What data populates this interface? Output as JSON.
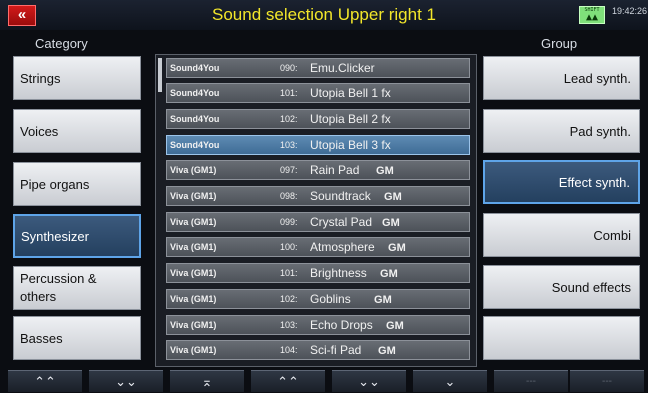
{
  "header": {
    "back_icon": "«",
    "title": "Sound selection Upper right 1",
    "rec_icon_text": "SHIFT",
    "rec_icon_glyph": "▲▲",
    "clock": "19:42:26"
  },
  "category": {
    "heading": "Category",
    "items": [
      {
        "label": "Strings"
      },
      {
        "label": "Voices"
      },
      {
        "label": "Pipe organs"
      },
      {
        "label": "Synthesizer"
      },
      {
        "label_line1": "Percussion &",
        "label_line2": "others"
      },
      {
        "label": "Basses"
      }
    ],
    "selected": "Synthesizer"
  },
  "group": {
    "heading": "Group",
    "items": [
      {
        "label": "Lead synth."
      },
      {
        "label": "Pad synth."
      },
      {
        "label": "Effect synth."
      },
      {
        "label": "Combi"
      },
      {
        "label": "Sound effects"
      },
      {
        "label": ""
      }
    ],
    "selected": "Effect synth."
  },
  "sounds": [
    {
      "source": "Sound4You",
      "number": "090:",
      "name": "Emu.Clicker",
      "gm": ""
    },
    {
      "source": "Sound4You",
      "number": "101:",
      "name": "Utopia Bell 1 fx",
      "gm": ""
    },
    {
      "source": "Sound4You",
      "number": "102:",
      "name": "Utopia Bell 2 fx",
      "gm": ""
    },
    {
      "source": "Sound4You",
      "number": "103:",
      "name": "Utopia Bell 3 fx",
      "gm": ""
    },
    {
      "source": "Viva (GM1)",
      "number": "097:",
      "name": "Rain Pad",
      "gm": "GM"
    },
    {
      "source": "Viva (GM1)",
      "number": "098:",
      "name": "Soundtrack",
      "gm": "GM"
    },
    {
      "source": "Viva (GM1)",
      "number": "099:",
      "name": "Crystal Pad",
      "gm": "GM"
    },
    {
      "source": "Viva (GM1)",
      "number": "100:",
      "name": "Atmosphere",
      "gm": "GM"
    },
    {
      "source": "Viva (GM1)",
      "number": "101:",
      "name": "Brightness",
      "gm": "GM"
    },
    {
      "source": "Viva (GM1)",
      "number": "102:",
      "name": "Goblins",
      "gm": "GM"
    },
    {
      "source": "Viva (GM1)",
      "number": "103:",
      "name": "Echo Drops",
      "gm": "GM"
    },
    {
      "source": "Viva (GM1)",
      "number": "104:",
      "name": "Sci-fi Pad",
      "gm": "GM"
    }
  ],
  "selected_sound": "Utopia Bell 3 fx",
  "bottom_bar": [
    {
      "icon": "double-chevron-up-icon",
      "glyph": "⌃⌃"
    },
    {
      "icon": "double-chevron-down-icon",
      "glyph": "⌄⌄"
    },
    {
      "icon": "scroll-top-icon",
      "glyph": "⌅"
    },
    {
      "icon": "chevron-up-icon",
      "glyph": "⌃⌃"
    },
    {
      "icon": "chevron-down-icon",
      "glyph": "⌄⌄"
    },
    {
      "icon": "scroll-bottom-icon",
      "glyph": "⌄"
    },
    {
      "icon": "empty-slot",
      "glyph": "---"
    },
    {
      "icon": "empty-slot",
      "glyph": "---"
    }
  ],
  "colors": {
    "title": "#f2e62a",
    "selected_row": "#4a78a3",
    "selected_button": "#2f4d6e",
    "back_button": "#c21616"
  }
}
